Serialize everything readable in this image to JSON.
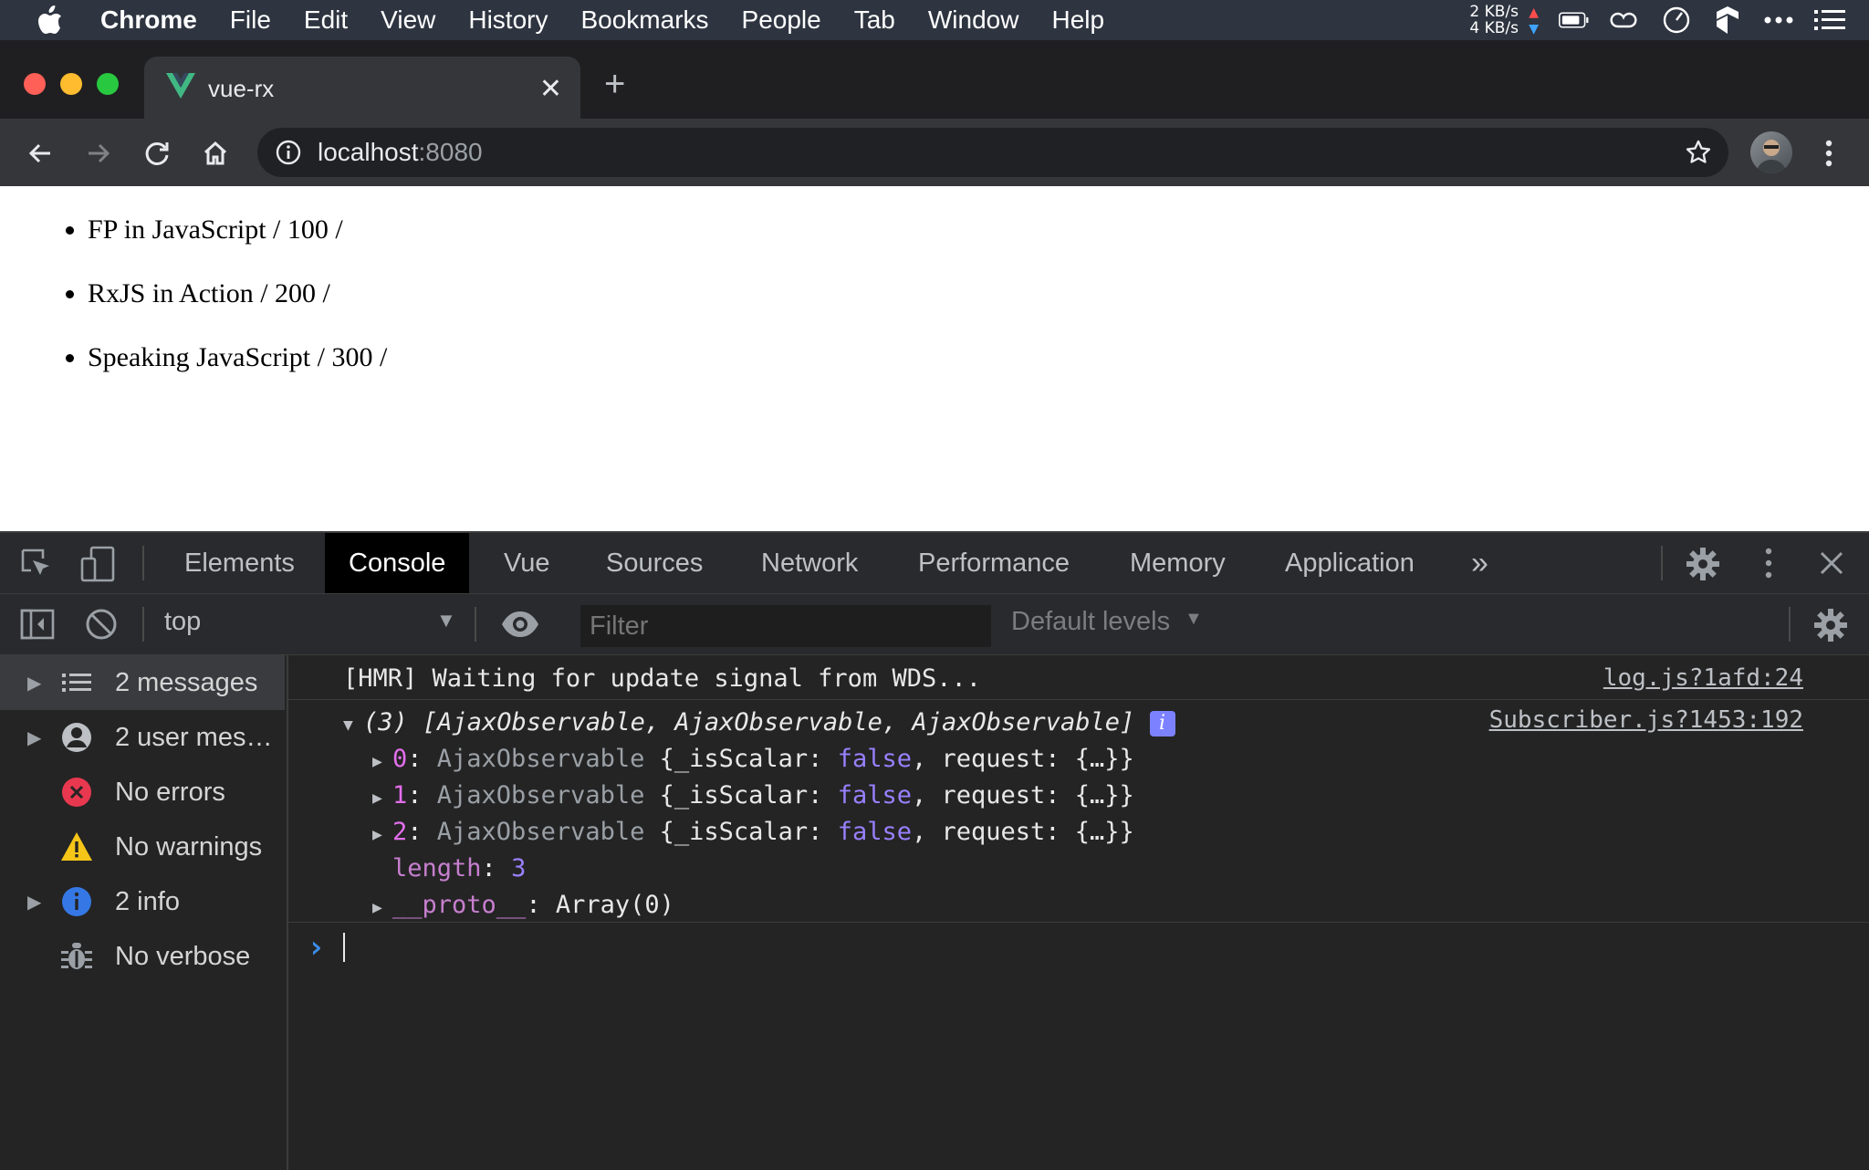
{
  "menubar": {
    "app": "Chrome",
    "items": [
      "File",
      "Edit",
      "View",
      "History",
      "Bookmarks",
      "People",
      "Tab",
      "Window",
      "Help"
    ],
    "net_up": "2 KB/s",
    "net_down": "4 KB/s"
  },
  "browser": {
    "tab_title": "vue-rx",
    "url_host": "localhost",
    "url_port": ":8080"
  },
  "page": {
    "items": [
      "FP in JavaScript / 100 /",
      "RxJS in Action / 200 /",
      "Speaking JavaScript / 300 /"
    ]
  },
  "devtools": {
    "tabs": [
      "Elements",
      "Console",
      "Vue",
      "Sources",
      "Network",
      "Performance",
      "Memory",
      "Application"
    ],
    "active_tab": "Console",
    "more_tabs": "»",
    "context": "top",
    "filter_placeholder": "Filter",
    "levels": "Default levels",
    "sidebar": [
      {
        "label": "2 messages",
        "icon": "list-icon"
      },
      {
        "label": "2 user mes…",
        "icon": "user-icon"
      },
      {
        "label": "No errors",
        "icon": "error-icon"
      },
      {
        "label": "No warnings",
        "icon": "warning-icon"
      },
      {
        "label": "2 info",
        "icon": "info-icon"
      },
      {
        "label": "No verbose",
        "icon": "bug-icon"
      }
    ],
    "console": {
      "msg1": "[HMR] Waiting for update signal from WDS...",
      "msg1_src": "log.js?1afd:24",
      "msg2_head": "(3) [AjaxObservable, AjaxObservable, AjaxObservable]",
      "msg2_src": "Subscriber.js?1453:192",
      "entries": [
        {
          "key": "0",
          "type": "AjaxObservable",
          "open": "{_isScalar: ",
          "val": "false",
          "rest": ", request: {…}}"
        },
        {
          "key": "1",
          "type": "AjaxObservable",
          "open": "{_isScalar: ",
          "val": "false",
          "rest": ", request: {…}}"
        },
        {
          "key": "2",
          "type": "AjaxObservable",
          "open": "{_isScalar: ",
          "val": "false",
          "rest": ", request: {…}}"
        }
      ],
      "length_key": "length",
      "length_val": "3",
      "proto_key": "__proto__",
      "proto_val": "Array(0)",
      "prompt": "›"
    }
  }
}
